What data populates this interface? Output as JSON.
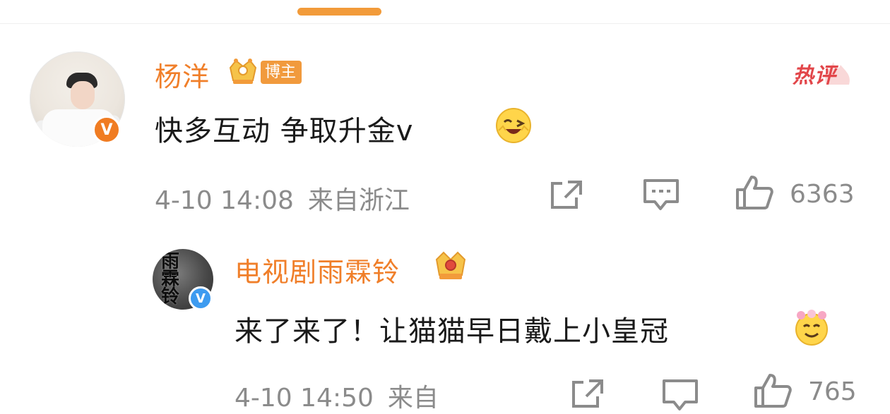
{
  "main_comment": {
    "username": "杨洋",
    "badge_label": "博主",
    "hot_label": "热评",
    "text": "快多互动 争取升金v",
    "time": "4-10 14:08",
    "location": "来自浙江",
    "like_count": "6363",
    "icons": [
      "crown-icon",
      "wink-emoji-icon",
      "share-icon",
      "comment-icon",
      "like-icon"
    ]
  },
  "reply": {
    "username": "电视剧雨霖铃",
    "avatar_text": "雨\n霖\n铃",
    "text": "来了来了！让猫猫早日戴上小皇冠",
    "time": "4-10 14:50",
    "location": "来自",
    "like_count": "765"
  },
  "colors": {
    "accent_orange": "#f07f2a",
    "tab_indicator": "#f29b3a",
    "hot_red": "#e2464a",
    "meta_gray": "#8b8b8b",
    "verified_orange": "#f07c22",
    "verified_blue": "#3d9bf0"
  }
}
